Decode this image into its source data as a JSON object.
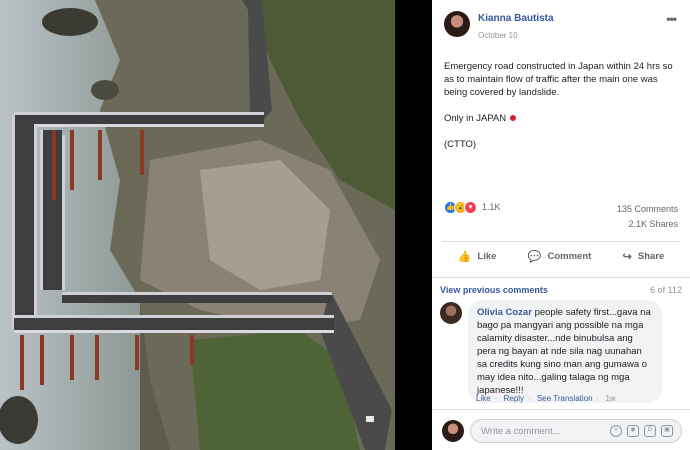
{
  "photo": {
    "description_icon": "landslide-road-photo"
  },
  "post": {
    "author": "Kianna Bautista",
    "date": "October 10",
    "paragraph_1": "Emergency road constructed in Japan within 24 hrs so as to maintain flow of traffic after the main one was being covered by landslide.",
    "paragraph_2": "Only in JAPAN",
    "paragraph_3": "(CTTO)",
    "reaction_count": "1.1K",
    "comments_count": "135 Comments",
    "shares_count": "2.1K Shares"
  },
  "actions": {
    "like": "Like",
    "comment": "Comment",
    "share": "Share"
  },
  "comments": {
    "view_previous": "View previous comments",
    "pagination": "6 of 112",
    "items": [
      {
        "author": "Olivia Cozar",
        "text": "people safety first...gava na bago pa mangyari ang possible na mga calamity disaster...nde binubulsa ang pera ng bayan at nde sila nag uunahan sa credits kung sino man ang gumawa o may idea nito...galing talaga ng mga japanese!!!",
        "like": "Like",
        "reply": "Reply",
        "translation": "See Translation",
        "time": "1w"
      }
    ],
    "write_placeholder": "Write a comment..."
  },
  "colors": {
    "link": "#385898",
    "meta": "#90949c",
    "like_reaction": "#1877f2",
    "love_reaction": "#f33e58",
    "wow_reaction": "#f7b125"
  }
}
